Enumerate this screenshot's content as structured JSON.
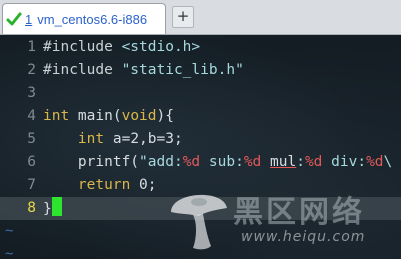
{
  "tab": {
    "number": "1",
    "title": "vm_centos6.6-i886",
    "new_tab_label": "+"
  },
  "editor": {
    "lines": [
      {
        "num": "1",
        "parts": [
          [
            "pp",
            "#include "
          ],
          [
            "str",
            "<stdio.h>"
          ]
        ]
      },
      {
        "num": "2",
        "parts": [
          [
            "pp",
            "#include "
          ],
          [
            "str",
            "\"static_lib.h\""
          ]
        ]
      },
      {
        "num": "3",
        "parts": []
      },
      {
        "num": "4",
        "parts": [
          [
            "kw",
            "int"
          ],
          [
            "plain",
            " main("
          ],
          [
            "kw",
            "void"
          ],
          [
            "plain",
            "){"
          ]
        ]
      },
      {
        "num": "5",
        "parts": [
          [
            "plain",
            "    "
          ],
          [
            "kw",
            "int"
          ],
          [
            "plain",
            " a=2,b=3;"
          ]
        ]
      },
      {
        "num": "6",
        "parts": [
          [
            "plain",
            "    printf("
          ],
          [
            "str",
            "\"add:"
          ],
          [
            "fmt",
            "%d"
          ],
          [
            "str",
            " sub:"
          ],
          [
            "fmt",
            "%d"
          ],
          [
            "str",
            " "
          ],
          [
            "err",
            "mul"
          ],
          [
            "str",
            ":"
          ],
          [
            "fmt",
            "%d"
          ],
          [
            "str",
            " div:"
          ],
          [
            "fmt",
            "%d"
          ],
          [
            "str",
            "\\"
          ]
        ]
      },
      {
        "num": "7",
        "parts": [
          [
            "plain",
            "    "
          ],
          [
            "kw",
            "return"
          ],
          [
            "plain",
            " 0;"
          ]
        ]
      },
      {
        "num": "8",
        "parts": [
          [
            "plain",
            "}"
          ],
          [
            "cursor",
            ""
          ]
        ],
        "current": true
      }
    ],
    "tilde_count": 2,
    "tilde_char": "~"
  },
  "watermark": {
    "title": "黑区网络",
    "url": "www.heiqu.com"
  },
  "colors": {
    "keyword": "#d9b64c",
    "string": "#a6d8de",
    "format": "#e05858",
    "line_number": "#7f8a8f",
    "current_line_number": "#e6d84a",
    "cursor": "#2ee52e",
    "tab_title": "#2b63c9"
  }
}
